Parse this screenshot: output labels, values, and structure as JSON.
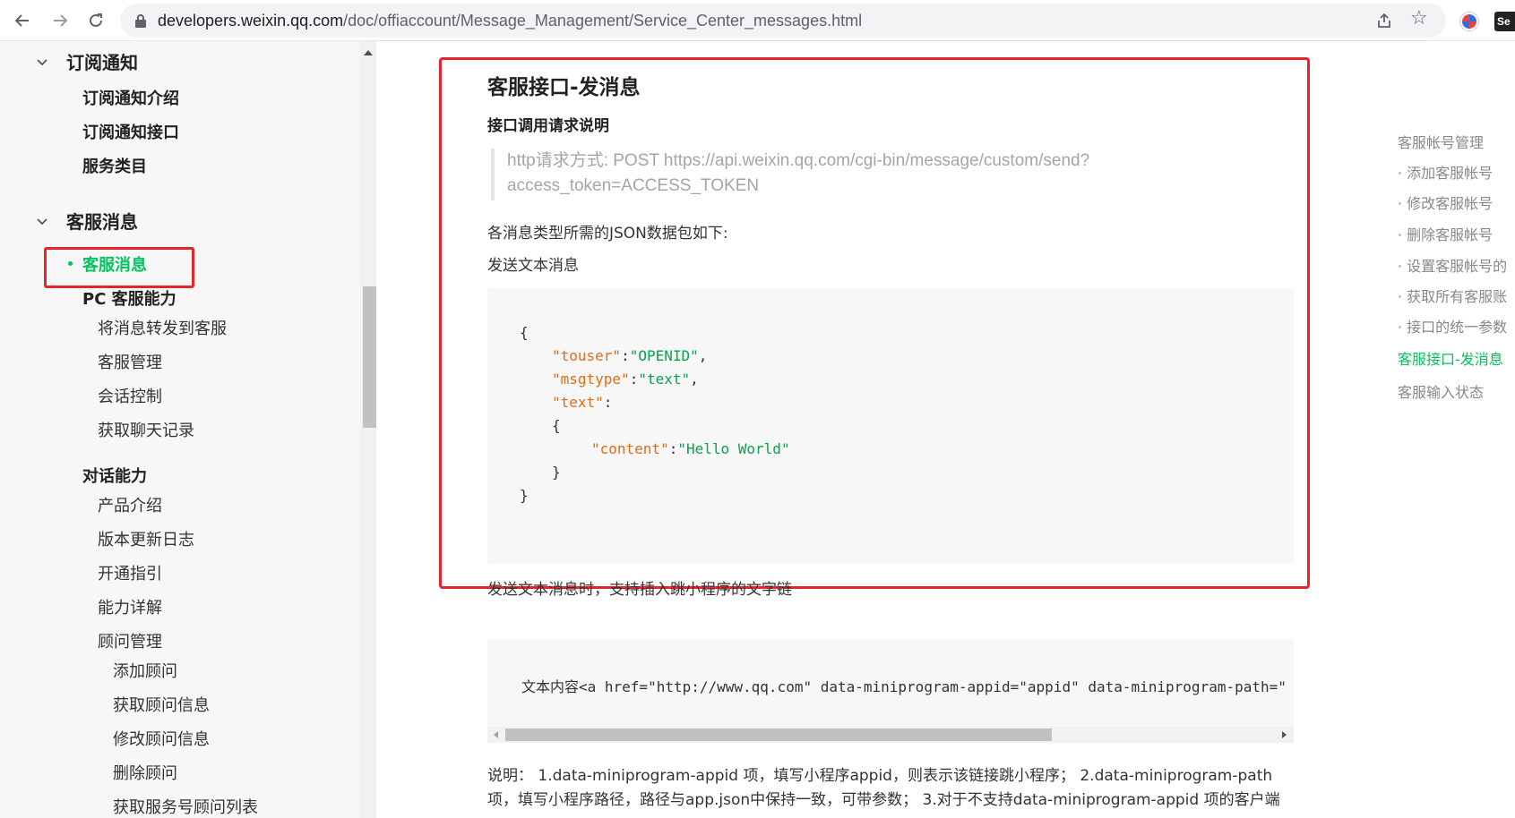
{
  "browser": {
    "url_host": "developers.weixin.qq.com",
    "url_path": "/doc/offiaccount/Message_Management/Service_Center_messages.html",
    "ext_label": "Se"
  },
  "sidebar": {
    "sections": [
      {
        "label": "订阅通知",
        "items": [
          "订阅通知介绍",
          "订阅通知接口",
          "服务类目"
        ]
      },
      {
        "label": "客服消息",
        "active_item": "客服消息",
        "pc_group": "PC 客服能力",
        "pc_items": [
          "将消息转发到客服",
          "客服管理",
          "会话控制",
          "获取聊天记录"
        ],
        "dialog_group": "对话能力",
        "dialog_items": [
          "产品介绍",
          "版本更新日志",
          "开通指引",
          "能力详解",
          "顾问管理"
        ],
        "advisor_items": [
          "添加顾问",
          "获取顾问信息",
          "修改顾问信息",
          "删除顾问",
          "获取服务号顾问列表"
        ]
      }
    ]
  },
  "content": {
    "title": "客服接口-发消息",
    "subtitle": "接口调用请求说明",
    "request_line1": "http请求方式: POST https://api.weixin.qq.com/cgi-bin/message/custom/send?",
    "request_line2": "access_token=ACCESS_TOKEN",
    "para_json": "各消息类型所需的JSON数据包如下:",
    "para_text_msg": "发送文本消息",
    "code": {
      "open_brace": "{",
      "touser_key": "\"touser\"",
      "touser_val": "\"OPENID\"",
      "msgtype_key": "\"msgtype\"",
      "msgtype_val": "\"text\"",
      "text_key": "\"text\"",
      "inner_open": "{",
      "content_key": "\"content\"",
      "content_val": "\"Hello World\"",
      "inner_close": "}",
      "close_brace": "}"
    },
    "para_link": "发送文本消息时，支持插入跳小程序的文字链",
    "code2": "文本内容<a href=\"http://www.qq.com\" data-miniprogram-appid=\"appid\" data-miniprogram-path=\"",
    "explain": "说明：  1.data-miniprogram-appid 项，填写小程序appid，则表示该链接跳小程序；  2.data-miniprogram-path 项，填写小程序路径，路径与app.json中保持一致，可带参数；  3.对于不支持data-miniprogram-appid 项的客户端"
  },
  "toc": {
    "items": [
      "客服帐号管理",
      "· 添加客服帐号",
      "· 修改客服帐号",
      "· 删除客服帐号",
      "· 设置客服帐号的",
      "· 获取所有客服账",
      "· 接口的统一参数",
      "客服接口-发消息",
      "客服输入状态"
    ],
    "active_index": 7
  },
  "colors": {
    "accent": "#07c160",
    "highlight_border": "#e8232a",
    "json_key": "#e06c14",
    "json_string": "#07a44c"
  }
}
